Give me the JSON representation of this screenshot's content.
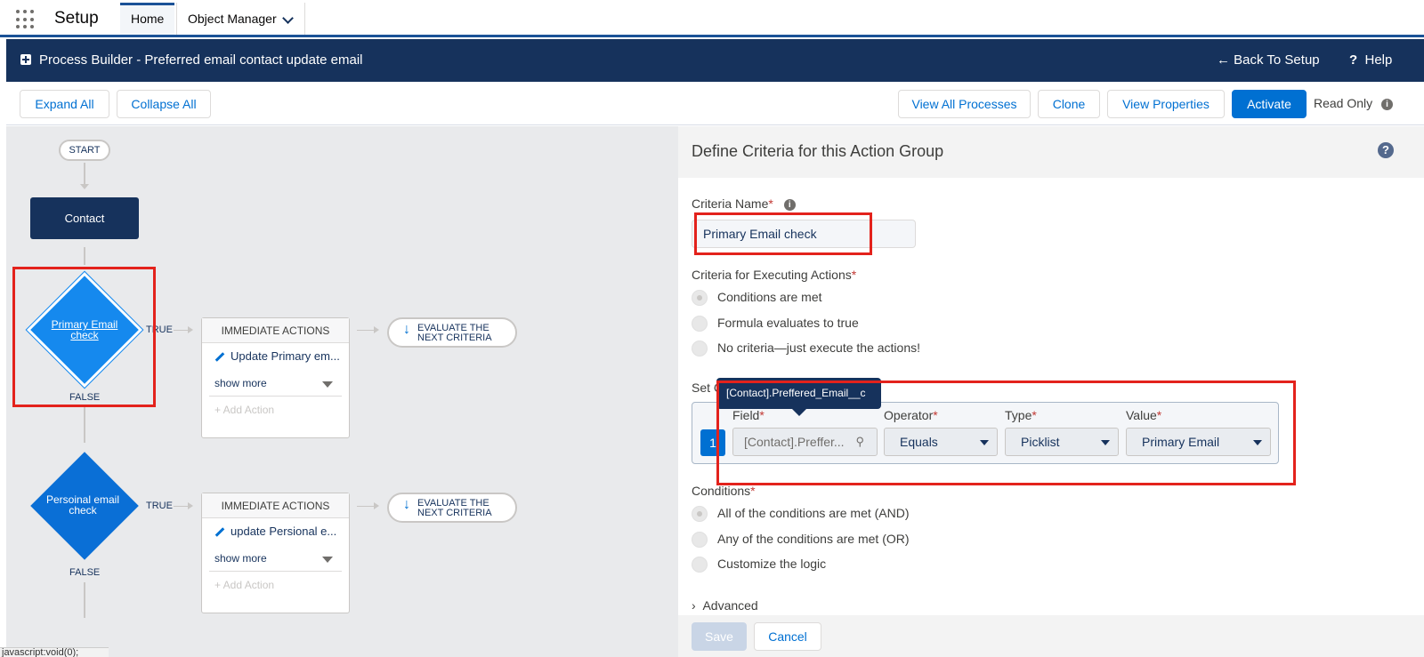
{
  "topnav": {
    "app_name": "Setup",
    "tabs": [
      {
        "label": "Home"
      },
      {
        "label": "Object Manager"
      }
    ]
  },
  "header": {
    "title": "Process Builder - Preferred email contact update email",
    "back_link": "Back To Setup",
    "help": "Help"
  },
  "toolbar": {
    "expand_all": "Expand All",
    "collapse_all": "Collapse All",
    "view_all": "View All Processes",
    "clone": "Clone",
    "view_properties": "View Properties",
    "activate": "Activate",
    "read_only": "Read Only"
  },
  "canvas": {
    "start": "START",
    "object": "Contact",
    "true_label": "TRUE",
    "false_label": "FALSE",
    "criteria": [
      {
        "name_line1": "Primary Email",
        "name_line2": "check",
        "action": "Update Primary em..."
      },
      {
        "name_line1": "Persoinal email",
        "name_line2": "check",
        "action": "update Persional e..."
      }
    ],
    "immediate_actions": "IMMEDIATE ACTIONS",
    "show_more": "show more",
    "add_action": "+ Add Action",
    "evaluate_line1": "EVALUATE THE",
    "evaluate_line2": "NEXT CRITERIA"
  },
  "status_text": "javascript:void(0);",
  "panel": {
    "title": "Define Criteria for this Action Group",
    "criteria_name_label": "Criteria Name",
    "criteria_name_value": "Primary Email check",
    "executing_label": "Criteria for Executing Actions",
    "executing_options": [
      "Conditions are met",
      "Formula evaluates to true",
      "No criteria—just execute the actions!"
    ],
    "set_conditions_label": "Set C",
    "tooltip": "[Contact].Preffered_Email__c",
    "field_label": "Field",
    "operator_label": "Operator",
    "type_label": "Type",
    "value_label": "Value",
    "row_number": "1",
    "field_value": "[Contact].Preffer...",
    "operator_value": "Equals",
    "type_value": "Picklist",
    "value_value": "Primary Email",
    "conditions_label": "Conditions",
    "conditions_options": [
      "All of the conditions are met (AND)",
      "Any of the conditions are met (OR)",
      "Customize the logic"
    ],
    "advanced": "Advanced",
    "save": "Save",
    "cancel": "Cancel"
  },
  "colors": {
    "brand_dark": "#16325c",
    "accent": "#0070d2",
    "highlight": "#e3221c"
  }
}
